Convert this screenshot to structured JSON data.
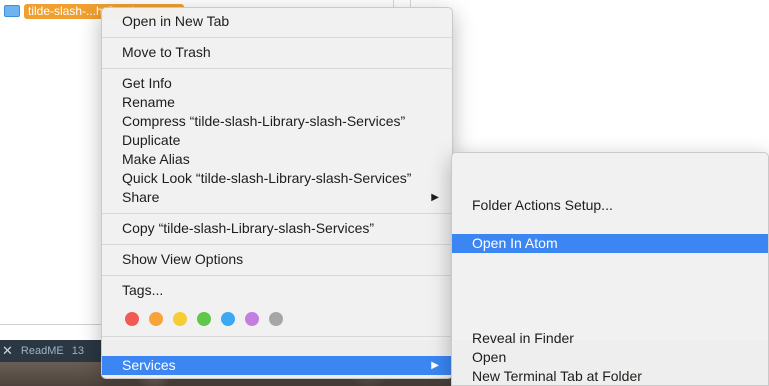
{
  "finder": {
    "selected_file": "tilde-slash-...h-Services"
  },
  "taskbar": {
    "close_glyph": "✕",
    "tab_label": "ReadME",
    "extra": "13"
  },
  "context_menu": {
    "items": {
      "open_new_tab": "Open in New Tab",
      "move_to_trash": "Move to Trash",
      "get_info": "Get Info",
      "rename": "Rename",
      "compress": "Compress “tilde-slash-Library-slash-Services”",
      "duplicate": "Duplicate",
      "make_alias": "Make Alias",
      "quick_look": "Quick Look “tilde-slash-Library-slash-Services”",
      "share": "Share",
      "copy": "Copy “tilde-slash-Library-slash-Services”",
      "show_view_options": "Show View Options",
      "tags": "Tags...",
      "services": "Services"
    },
    "submenu_arrow": "▶",
    "tag_colors": [
      "#f25a55",
      "#f6a33b",
      "#f5cd35",
      "#5fc74a",
      "#3aa8f2",
      "#c27ee0",
      "#a6a6a6"
    ]
  },
  "services_menu": {
    "items": {
      "folder_actions_setup": "Folder Actions Setup...",
      "open_in_atom": "Open In Atom",
      "reveal_in_finder": "Reveal in Finder",
      "open": "Open",
      "new_terminal_tab": "New Terminal Tab at Folder"
    }
  },
  "colors": {
    "highlight": "#3b86f2",
    "menu_background": "#f1f1f1",
    "selection_orange": "#f0a030"
  }
}
